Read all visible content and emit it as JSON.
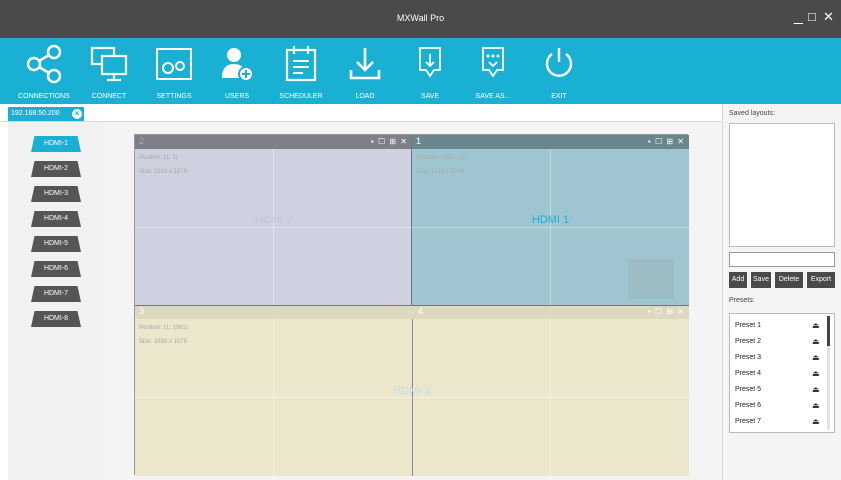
{
  "window": {
    "title": "MXWall Pro",
    "minimize": "_",
    "maximize": "□",
    "close": "✕"
  },
  "toolbar": {
    "items": [
      {
        "label": "CONNECTIONS",
        "icon": "connections-icon"
      },
      {
        "label": "CONNECT",
        "icon": "monitors-icon"
      },
      {
        "label": "SETTINGS",
        "icon": "settings-icon"
      },
      {
        "label": "USERS",
        "icon": "add-user-icon"
      },
      {
        "label": "SCHEDULER",
        "icon": "calendar-icon"
      },
      {
        "label": "LOAD",
        "icon": "download-icon"
      },
      {
        "label": "SAVE",
        "icon": "save-icon"
      },
      {
        "label": "SAVE AS...",
        "icon": "save-as-icon"
      },
      {
        "label": "EXIT",
        "icon": "power-icon"
      }
    ],
    "color": "#1ab0d3"
  },
  "tab": {
    "label": "192.168.50.200",
    "close": "×"
  },
  "sources": {
    "items": [
      "HDMI-1",
      "HDMI-2",
      "HDMI-3",
      "HDMI-4",
      "HDMI-5",
      "HDMI-6",
      "HDMI-7",
      "HDMI-8"
    ],
    "active": "HDMI-1"
  },
  "wall": {
    "windows": [
      {
        "num": "2",
        "position": "Position: (1; 1)",
        "size": "Size: 1919 x 1079",
        "name": "HDMI 2",
        "controls": "▪ ☐ ⊞ ✕"
      },
      {
        "num": "1",
        "position": "Position: (1921; 1)",
        "size": "Size: 1919 x 1079",
        "name": "HDMI 1",
        "controls": "▪ ☐ ⊞ ✕"
      },
      {
        "num": "3",
        "position": "Position: (1; 1081)",
        "size": "Size: 3839 x 1079",
        "name": "HDMI 3",
        "controls": "▪ ☐ ⊞ ✕"
      }
    ],
    "secondary_num": "4"
  },
  "right_panel": {
    "saved_label": "Saved layouts:",
    "layout_name_value": "",
    "buttons": {
      "add": "Add",
      "save": "Save",
      "delete": "Delete",
      "export": "Export"
    },
    "presets_label": "Presets:",
    "presets": [
      "Preset 1",
      "Preset 2",
      "Preset 3",
      "Preset 4",
      "Preset 5",
      "Preset 6",
      "Preset 7"
    ],
    "preset_icon": "⏏"
  }
}
